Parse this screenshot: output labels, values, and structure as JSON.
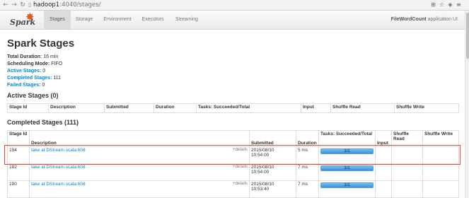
{
  "browser": {
    "url_host": "hadoop1",
    "url_path": ":4040/stages/"
  },
  "navbar": {
    "logo_text": "Spark",
    "tabs": [
      {
        "label": "Stages",
        "active": true
      },
      {
        "label": "Storage",
        "active": false
      },
      {
        "label": "Environment",
        "active": false
      },
      {
        "label": "Executors",
        "active": false
      },
      {
        "label": "Streaming",
        "active": false
      }
    ],
    "app_name": "FileWordCount",
    "app_suffix": " application UI"
  },
  "page": {
    "title": "Spark Stages",
    "summary": {
      "total_duration_label": "Total Duration:",
      "total_duration_value": " 16 min",
      "scheduling_mode_label": "Scheduling Mode:",
      "scheduling_mode_value": " FIFO",
      "active_stages_label": "Active Stages:",
      "active_stages_value": " 0",
      "completed_stages_label": "Completed Stages:",
      "completed_stages_value": " 111",
      "failed_stages_label": "Failed Stages:",
      "failed_stages_value": " 0"
    }
  },
  "active_stages": {
    "heading": "Active Stages (0)",
    "columns": [
      "Stage Id",
      "Description",
      "Submitted",
      "Duration",
      "Tasks: Succeeded/Total",
      "Input",
      "Shuffle Read",
      "Shuffle Write"
    ]
  },
  "completed_stages": {
    "heading": "Completed Stages (111)",
    "columns": [
      "Stage Id",
      "Description",
      "Submitted",
      "Duration",
      "Tasks: Succeeded/Total",
      "Input",
      "Shuffle Read",
      "Shuffle Write"
    ],
    "details_label": "+details",
    "rows": [
      {
        "id": "194",
        "description": "take at DStream.scala:608",
        "submitted_date": "2015/08/10",
        "submitted_time": "10:54:00",
        "duration": "5 ms",
        "tasks": "1/1",
        "progress": 1.0
      },
      {
        "id": "192",
        "description": "take at DStream.scala:608",
        "submitted_date": "2015/08/10",
        "submitted_time": "10:54:00",
        "duration": "7 ms",
        "tasks": "1/1",
        "progress": 1.0
      },
      {
        "id": "190",
        "description": "take at DStream.scala:608",
        "submitted_date": "2015/08/10",
        "submitted_time": "10:53:40",
        "duration": "7 ms",
        "tasks": "1/1",
        "progress": 1.0
      }
    ]
  }
}
